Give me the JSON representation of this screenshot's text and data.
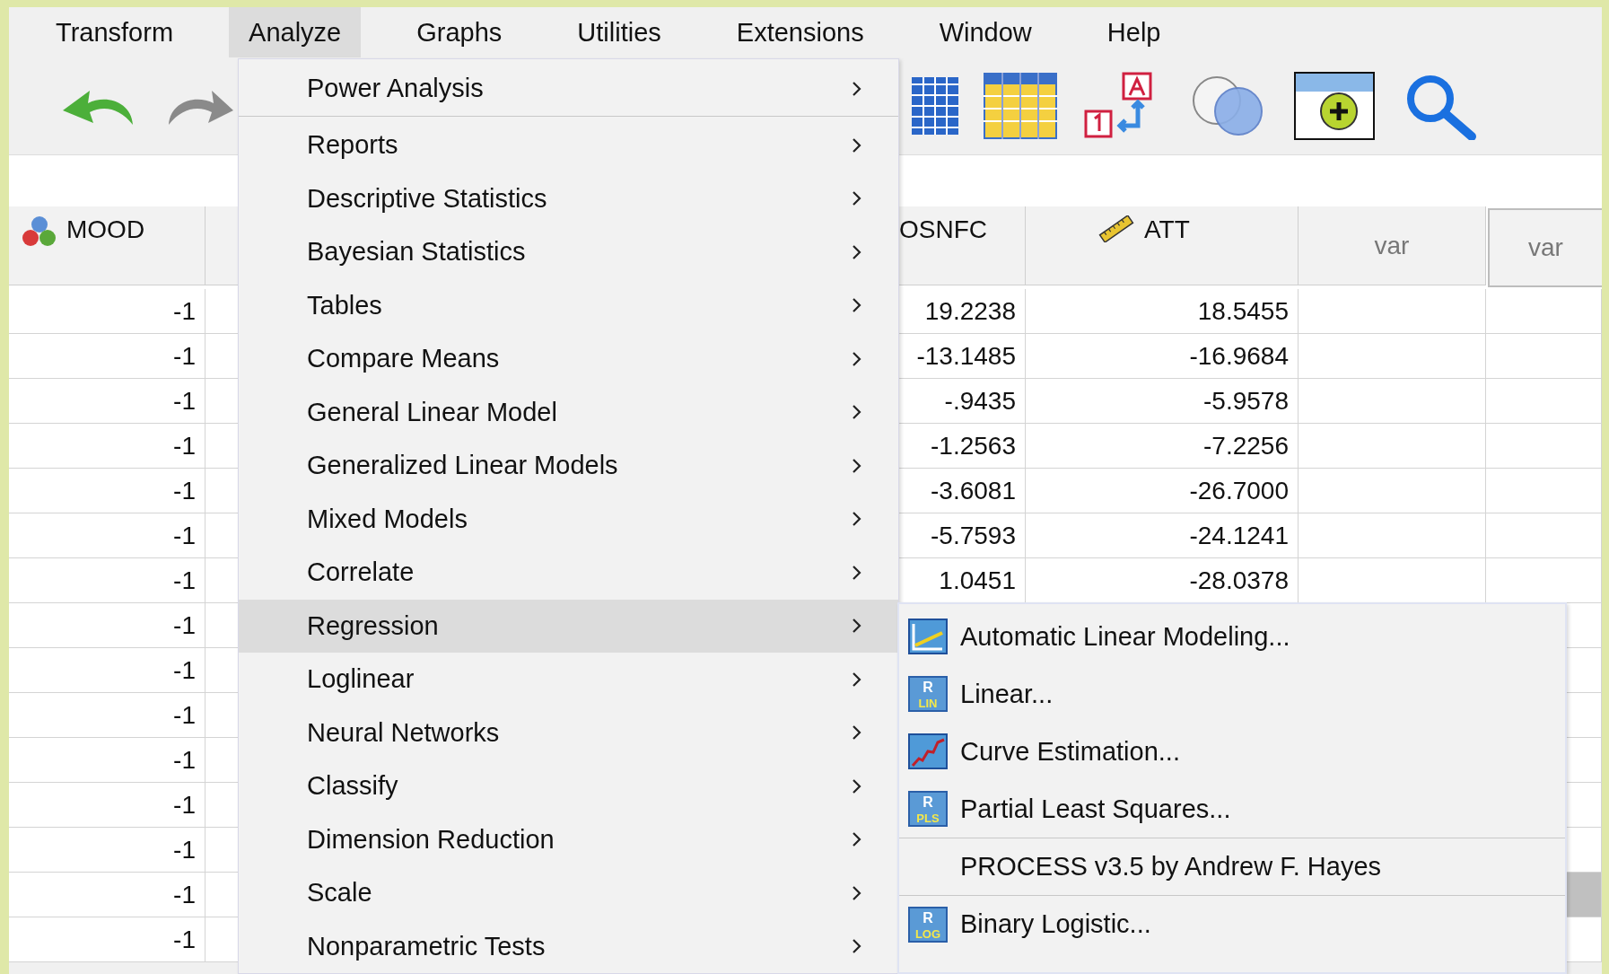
{
  "menubar": [
    {
      "label": "Transform",
      "selected": false
    },
    {
      "label": "Analyze",
      "selected": true
    },
    {
      "label": "Graphs",
      "selected": false
    },
    {
      "label": "Utilities",
      "selected": false
    },
    {
      "label": "Extensions",
      "selected": false
    },
    {
      "label": "Window",
      "selected": false
    },
    {
      "label": "Help",
      "selected": false
    }
  ],
  "table": {
    "columns": [
      {
        "label": "MOOD",
        "kind": "nominal",
        "selected": false
      },
      {
        "label": "OSNFC",
        "kind": "variable",
        "selected": false
      },
      {
        "label": "ATT",
        "kind": "scale",
        "selected": false
      },
      {
        "label": "var",
        "kind": "empty",
        "selected": false
      },
      {
        "label": "var",
        "kind": "empty",
        "selected": true
      }
    ],
    "rows": [
      {
        "cells": [
          "-1",
          "19.2238",
          "18.5455"
        ],
        "selected": false
      },
      {
        "cells": [
          "-1",
          "-13.1485",
          "-16.9684"
        ],
        "selected": false
      },
      {
        "cells": [
          "-1",
          "-.9435",
          "-5.9578"
        ],
        "selected": false
      },
      {
        "cells": [
          "-1",
          "-1.2563",
          "-7.2256"
        ],
        "selected": false
      },
      {
        "cells": [
          "-1",
          "-3.6081",
          "-26.7000"
        ],
        "selected": false
      },
      {
        "cells": [
          "-1",
          "-5.7593",
          "-24.1241"
        ],
        "selected": false
      },
      {
        "cells": [
          "-1",
          "1.0451",
          "-28.0378"
        ],
        "selected": false
      },
      {
        "cells": [
          "-1"
        ],
        "selected": false
      },
      {
        "cells": [
          "-1"
        ],
        "selected": false
      },
      {
        "cells": [
          "-1"
        ],
        "selected": false
      },
      {
        "cells": [
          "-1"
        ],
        "selected": false
      },
      {
        "cells": [
          "-1"
        ],
        "selected": false
      },
      {
        "cells": [
          "-1"
        ],
        "selected": false
      },
      {
        "cells": [
          "-1"
        ],
        "selected": true
      },
      {
        "cells": [
          "-1"
        ],
        "selected": false
      }
    ]
  },
  "analyze_menu": {
    "items": [
      {
        "label": "Power Analysis",
        "submenu": true,
        "selected": false,
        "separator_after": true
      },
      {
        "label": "Reports",
        "submenu": true,
        "selected": false,
        "separator_after": false
      },
      {
        "label": "Descriptive Statistics",
        "submenu": true,
        "selected": false,
        "separator_after": false
      },
      {
        "label": "Bayesian Statistics",
        "submenu": true,
        "selected": false,
        "separator_after": false
      },
      {
        "label": "Tables",
        "submenu": true,
        "selected": false,
        "separator_after": false
      },
      {
        "label": "Compare Means",
        "submenu": true,
        "selected": false,
        "separator_after": false
      },
      {
        "label": "General Linear Model",
        "submenu": true,
        "selected": false,
        "separator_after": false
      },
      {
        "label": "Generalized Linear Models",
        "submenu": true,
        "selected": false,
        "separator_after": false
      },
      {
        "label": "Mixed Models",
        "submenu": true,
        "selected": false,
        "separator_after": false
      },
      {
        "label": "Correlate",
        "submenu": true,
        "selected": false,
        "separator_after": false
      },
      {
        "label": "Regression",
        "submenu": true,
        "selected": true,
        "separator_after": false
      },
      {
        "label": "Loglinear",
        "submenu": true,
        "selected": false,
        "separator_after": false
      },
      {
        "label": "Neural Networks",
        "submenu": true,
        "selected": false,
        "separator_after": false
      },
      {
        "label": "Classify",
        "submenu": true,
        "selected": false,
        "separator_after": false
      },
      {
        "label": "Dimension Reduction",
        "submenu": true,
        "selected": false,
        "separator_after": false
      },
      {
        "label": "Scale",
        "submenu": true,
        "selected": false,
        "separator_after": false
      },
      {
        "label": "Nonparametric Tests",
        "submenu": true,
        "selected": false,
        "separator_after": false
      }
    ]
  },
  "regression_submenu": {
    "items": [
      {
        "label": "Automatic Linear Modeling...",
        "icon": {
          "kind": "auto-linear"
        },
        "separator_before": false
      },
      {
        "label": "Linear...",
        "icon": {
          "kind": "r-badge",
          "top": "R",
          "bottom": "LIN"
        },
        "separator_before": false
      },
      {
        "label": "Curve Estimation...",
        "icon": {
          "kind": "curve"
        },
        "separator_before": false
      },
      {
        "label": "Partial Least Squares...",
        "icon": {
          "kind": "r-badge",
          "top": "R",
          "bottom": "PLS"
        },
        "separator_before": false
      },
      {
        "label": "PROCESS v3.5 by Andrew F. Hayes",
        "separator_before": true
      },
      {
        "label": "Binary Logistic...",
        "icon": {
          "kind": "r-badge",
          "top": "R",
          "bottom": "LOG"
        },
        "separator_before": true
      }
    ]
  }
}
